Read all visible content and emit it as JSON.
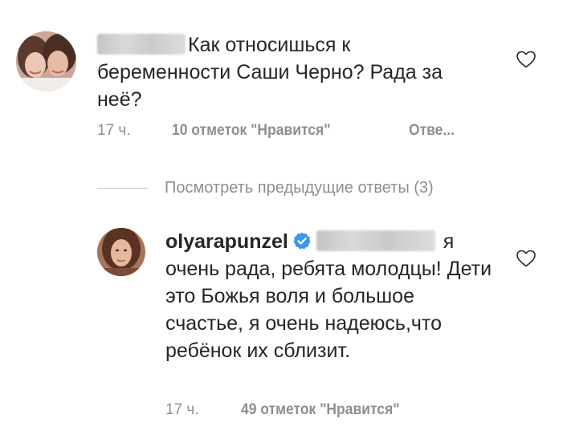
{
  "comments": [
    {
      "text": "Как относишься к беременности Саши Черно? Рада за неё?",
      "time": "17 ч.",
      "likes": "10 отметок \"Нравится\"",
      "reply": "Отве..."
    },
    {
      "username": "olyarapunzel",
      "mention_tail": "я",
      "text": "очень рада, ребята молодцы! Дети это Божья воля и большое счастье, я очень надеюсь,что ребёнок их сблизит.",
      "time": "17 ч.",
      "likes": "49 отметок \"Нравится\""
    }
  ],
  "view_replies": "Посмотреть предыдущие ответы (3)",
  "icons": {
    "heart": "heart-outline-icon",
    "verified": "verified-badge-icon"
  },
  "colors": {
    "text": "#262626",
    "meta": "#8e8e8e",
    "verified": "#3897f0"
  }
}
